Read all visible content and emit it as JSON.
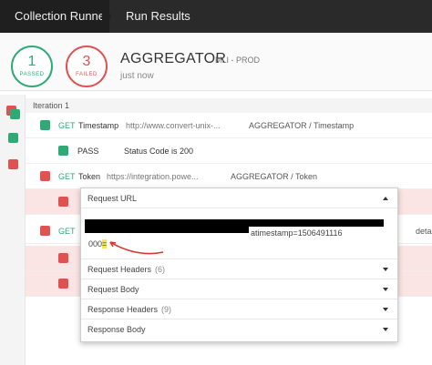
{
  "topbar": {
    "collection_runner": "Collection Runner",
    "run_results": "Run Results"
  },
  "summary": {
    "passed_count": "1",
    "passed_label": "PASSED",
    "failed_count": "3",
    "failed_label": "FAILED",
    "collection_name": "AGGREGATOR",
    "environment": "MLI - PROD",
    "time": "just now"
  },
  "iteration": {
    "label": "Iteration 1"
  },
  "requests": [
    {
      "method": "GET",
      "name": "Timestamp",
      "url": "http://www.convert-unix-...",
      "path": "AGGREGATOR / Timestamp",
      "status": "pass"
    },
    {
      "test_status": "PASS",
      "test_name": "Status Code is 200"
    },
    {
      "method": "GET",
      "name": "Token",
      "url": "https://integration.powe...",
      "path": "AGGREGATOR / Token",
      "status": "fail"
    },
    {
      "method": "GET",
      "name": "",
      "detail_link": "details",
      "status": "fail"
    }
  ],
  "popup": {
    "request_url_label": "Request URL",
    "url_visible_tail": "atimestamp=1506491116",
    "url_second_line_prefix": "000",
    "url_highlight": "=",
    "sections": [
      {
        "label": "Request Headers",
        "count": "(6)"
      },
      {
        "label": "Request Body",
        "count": ""
      },
      {
        "label": "Response Headers",
        "count": "(9)"
      },
      {
        "label": "Response Body",
        "count": ""
      }
    ]
  },
  "colors": {
    "pass": "#2eaa77",
    "fail": "#e05252",
    "topbar": "#2a2a2a",
    "fail_row_bg": "#fbe4e4"
  }
}
